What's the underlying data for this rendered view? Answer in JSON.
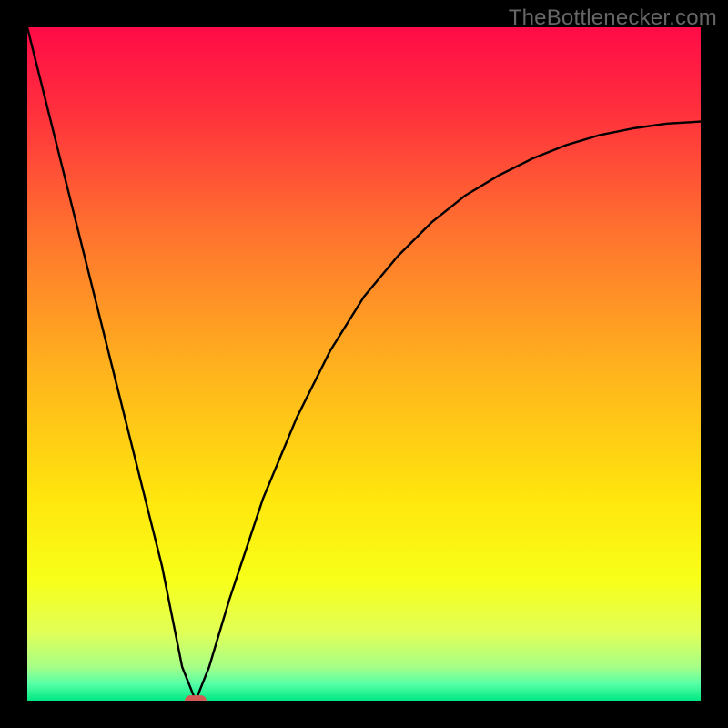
{
  "watermark": "TheBottlenecker.com",
  "chart_data": {
    "type": "line",
    "title": "",
    "xlabel": "",
    "ylabel": "",
    "xlim": [
      0,
      100
    ],
    "ylim": [
      0,
      100
    ],
    "background": {
      "type": "vertical-gradient",
      "stops": [
        {
          "pos": 0.0,
          "color": "#ff0b47"
        },
        {
          "pos": 0.12,
          "color": "#ff2e3d"
        },
        {
          "pos": 0.3,
          "color": "#ff712f"
        },
        {
          "pos": 0.5,
          "color": "#ffb01e"
        },
        {
          "pos": 0.7,
          "color": "#ffe60d"
        },
        {
          "pos": 0.82,
          "color": "#f8ff18"
        },
        {
          "pos": 0.9,
          "color": "#e0ff58"
        },
        {
          "pos": 0.95,
          "color": "#a6ff88"
        },
        {
          "pos": 0.975,
          "color": "#57ffa6"
        },
        {
          "pos": 1.0,
          "color": "#00e884"
        }
      ]
    },
    "curve": {
      "comment": "V/check-shaped curve. x in [0,100] maps to horizontal extent; y in [0,100] maps to vertical extent (0 at bottom). Left branch is linear from (0,100) down to the minimum; right branch rises with diminishing slope toward (100, ~86).",
      "min_x": 25,
      "points": [
        {
          "x": 0,
          "y": 100
        },
        {
          "x": 5,
          "y": 80
        },
        {
          "x": 10,
          "y": 60
        },
        {
          "x": 15,
          "y": 40
        },
        {
          "x": 20,
          "y": 20
        },
        {
          "x": 23,
          "y": 5
        },
        {
          "x": 25,
          "y": 0
        },
        {
          "x": 27,
          "y": 5
        },
        {
          "x": 30,
          "y": 15
        },
        {
          "x": 35,
          "y": 30
        },
        {
          "x": 40,
          "y": 42
        },
        {
          "x": 45,
          "y": 52
        },
        {
          "x": 50,
          "y": 60
        },
        {
          "x": 55,
          "y": 66
        },
        {
          "x": 60,
          "y": 71
        },
        {
          "x": 65,
          "y": 75
        },
        {
          "x": 70,
          "y": 78
        },
        {
          "x": 75,
          "y": 80.5
        },
        {
          "x": 80,
          "y": 82.5
        },
        {
          "x": 85,
          "y": 84
        },
        {
          "x": 90,
          "y": 85
        },
        {
          "x": 95,
          "y": 85.7
        },
        {
          "x": 100,
          "y": 86
        }
      ]
    },
    "marker": {
      "x": 25,
      "y": 0,
      "shape": "rounded-rect",
      "width_pct": 3.2,
      "height_pct": 1.6,
      "color": "#d45a55"
    }
  }
}
